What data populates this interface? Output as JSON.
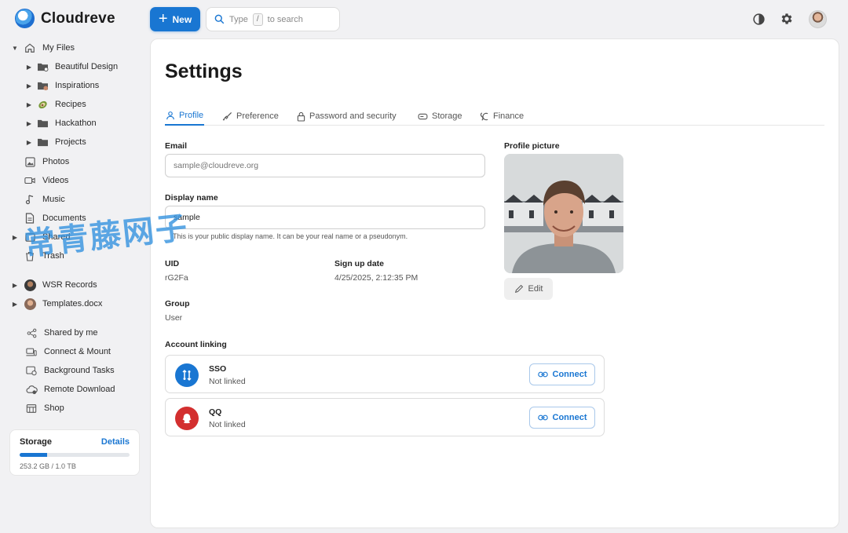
{
  "app": {
    "name": "Cloudreve"
  },
  "toolbar": {
    "new_label": "New"
  },
  "search": {
    "prefix": "Type",
    "kbd": "/",
    "suffix": "to search"
  },
  "sidebar": {
    "my_files": "My Files",
    "folders": [
      "Beautiful Design",
      "Inspirations",
      "Recipes",
      "Hackathon",
      "Projects"
    ],
    "media": [
      "Photos",
      "Videos",
      "Music",
      "Documents"
    ],
    "hidden_item_prefix": "Shared",
    "hidden_item_2": "Trash",
    "shared_files": [
      "WSR Records",
      "Templates.docx"
    ],
    "tools": [
      "Shared by me",
      "Connect & Mount",
      "Background Tasks",
      "Remote Download",
      "Shop"
    ]
  },
  "storage": {
    "label": "Storage",
    "details": "Details",
    "used_text": "253.2 GB / 1.0 TB",
    "used_fraction": 0.2532
  },
  "settings": {
    "title": "Settings",
    "tabs": [
      "Profile",
      "Preference",
      "Password and security",
      "Storage",
      "Finance"
    ],
    "email_label": "Email",
    "email_placeholder": "sample@cloudreve.org",
    "display_name_label": "Display name",
    "display_name_value": "sample",
    "display_name_helper": "This is your public display name. It can be your real name or a pseudonym.",
    "uid_label": "UID",
    "uid_value": "rG2Fa",
    "signup_label": "Sign up date",
    "signup_value": "4/25/2025, 2:12:35 PM",
    "group_label": "Group",
    "group_value": "User",
    "profile_picture_label": "Profile picture",
    "edit_label": "Edit",
    "account_linking_label": "Account linking",
    "links": [
      {
        "name": "SSO",
        "status": "Not linked",
        "action": "Connect",
        "color": "#1976d2"
      },
      {
        "name": "QQ",
        "status": "Not linked",
        "action": "Connect",
        "color": "#d32f2f"
      }
    ]
  },
  "watermark": "常青藤网子",
  "colors": {
    "accent": "#1976d2",
    "qq": "#d32f2f"
  }
}
